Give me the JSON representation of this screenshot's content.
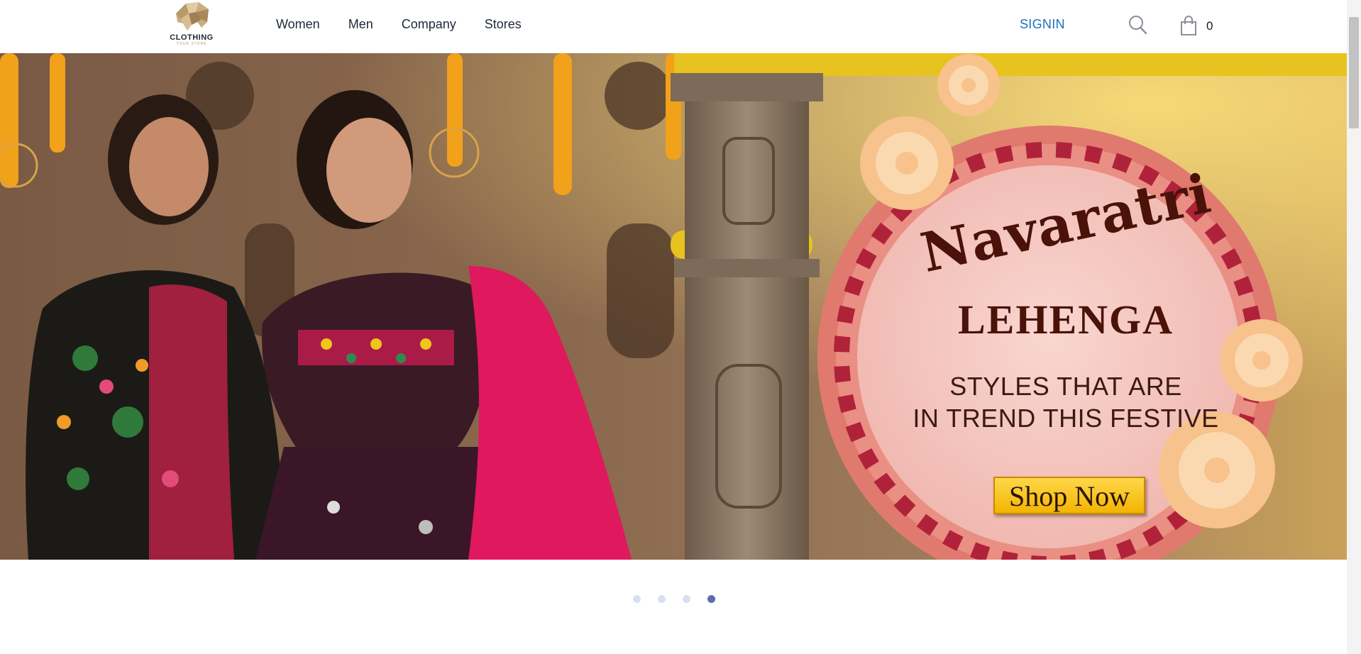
{
  "header": {
    "logo": {
      "word": "CLOTHING",
      "tagline": "YOUR STORE",
      "icon": "elephant-logo-icon"
    },
    "nav": [
      {
        "label": "Women"
      },
      {
        "label": "Men"
      },
      {
        "label": "Company"
      },
      {
        "label": "Stores"
      }
    ],
    "signin_label": "SIGNIN",
    "search_icon": "search-icon",
    "cart": {
      "icon": "shopping-bag-icon",
      "count": "0"
    }
  },
  "hero": {
    "headline_1": "Navaratri",
    "headline_2": "LEHENGA",
    "sub_1": "STYLES THAT ARE",
    "sub_2": "IN TREND THIS FESTIVE",
    "cta_label": "Shop Now",
    "colors": {
      "circle": "#f5c6c0",
      "headline": "#4a1208",
      "cta": "#f7c31c",
      "petal": "#e07a6e"
    }
  },
  "carousel": {
    "slide_count": 4,
    "active_index": 3,
    "active_color": "#5a6cb3",
    "inactive_color": "#d9dff2"
  },
  "brand_colors": {
    "signin": "#1e6fc0",
    "text": "#1f2937"
  }
}
